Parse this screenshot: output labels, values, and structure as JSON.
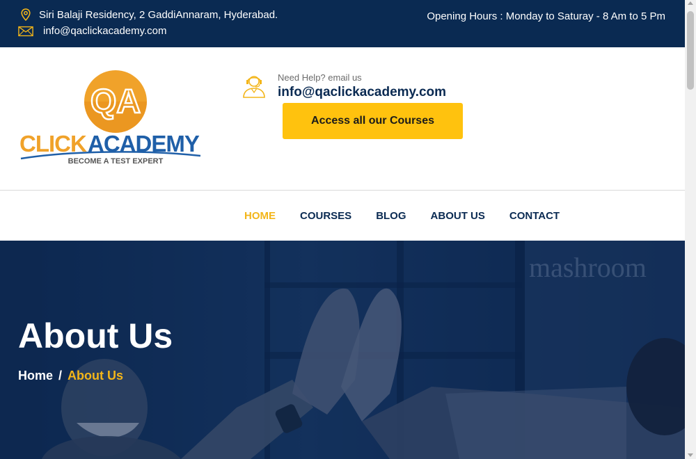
{
  "topbar": {
    "address": "Siri Balaji Residency, 2 GaddiAnnaram, Hyderabad.",
    "email": "info@qaclickacademy.com",
    "hours": "Opening Hours : Monday to Saturay - 8 Am to 5 Pm",
    "address_icon": "location-pin-icon",
    "email_icon": "envelope-icon"
  },
  "logo": {
    "monogram": "QA",
    "word_left": "CLICK",
    "word_right": "ACADEMY",
    "tagline": "BECOME A TEST EXPERT"
  },
  "help": {
    "label": "Need Help? email us",
    "email": "info@qaclickacademy.com",
    "icon": "support-agent-icon"
  },
  "cta": {
    "label": "Access all our Courses"
  },
  "nav": {
    "items": [
      {
        "label": "HOME",
        "active": true
      },
      {
        "label": "COURSES",
        "active": false
      },
      {
        "label": "BLOG",
        "active": false
      },
      {
        "label": "ABOUT US",
        "active": false
      },
      {
        "label": "CONTACT",
        "active": false
      }
    ]
  },
  "hero": {
    "title": "About Us",
    "breadcrumb": {
      "home": "Home",
      "separator": "/",
      "current": "About Us"
    },
    "background_text": "mashroom"
  },
  "colors": {
    "navy": "#0a2a52",
    "accent_yellow": "#ffc20e",
    "active_nav": "#f3b519",
    "logo_orange": "#f0a22a",
    "logo_blue": "#1f5fa8"
  }
}
